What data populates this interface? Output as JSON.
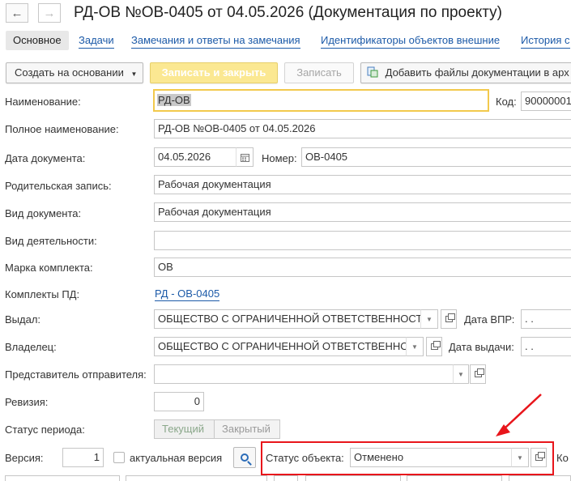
{
  "window": {
    "title": "РД-ОВ №ОВ-0405 от 04.05.2026 (Документация по проекту)"
  },
  "nav": {
    "back_glyph": "←",
    "forward_glyph": "→"
  },
  "tabs": [
    {
      "label": "Основное"
    },
    {
      "label": "Задачи"
    },
    {
      "label": "Замечания и ответы на замечания"
    },
    {
      "label": "Идентификаторы объектов внешние"
    },
    {
      "label": "История с"
    }
  ],
  "toolbar": {
    "create_based_label": "Создать на основании",
    "save_close_label": "Записать и закрыть",
    "save_label": "Записать",
    "add_files_label": "Добавить файлы документации в арх"
  },
  "form": {
    "name_label": "Наименование:",
    "name_value": "РД-ОВ",
    "code_label": "Код:",
    "code_value": "90000001",
    "full_name_label": "Полное наименование:",
    "full_name_value": "РД-ОВ №ОВ-0405 от 04.05.2026",
    "doc_date_label": "Дата документа:",
    "doc_date_value": "04.05.2026",
    "number_label": "Номер:",
    "number_value": "ОВ-0405",
    "parent_label": "Родительская запись:",
    "parent_value": "Рабочая документация",
    "doc_type_label": "Вид документа:",
    "doc_type_value": "Рабочая документация",
    "activity_label": "Вид деятельности:",
    "activity_value": "",
    "mark_label": "Марка комплекта:",
    "mark_value": "ОВ",
    "pd_sets_label": "Комплекты ПД:",
    "pd_sets_value": "РД - ОВ-0405",
    "issued_label": "Выдал:",
    "issued_value": "ОБЩЕСТВО С ОГРАНИЧЕННОЙ ОТВЕТСТВЕННОСТЬЮ",
    "vpr_date_label": "Дата ВПР:",
    "vpr_date_value": " .  .",
    "owner_label": "Владелец:",
    "owner_value": "ОБЩЕСТВО С ОГРАНИЧЕННОЙ ОТВЕТСТВЕННОСТЬЮ",
    "issue_date_label": "Дата выдачи:",
    "issue_date_value": " .  .",
    "sender_rep_label": "Представитель отправителя:",
    "sender_rep_value": "",
    "revision_label": "Ревизия:",
    "revision_value": "0",
    "period_status_label": "Статус периода:",
    "period_current": "Текущий",
    "period_closed": "Закрытый",
    "version_label": "Версия:",
    "version_value": "1",
    "actual_version_label": "актуальная версия",
    "object_status_label": "Статус объекта:",
    "object_status_value": "Отменено",
    "cut_label": "Ко"
  },
  "colors": {
    "accent_link": "#1c5aa8",
    "primary_button": "#fbe892",
    "focus_border": "#f2c94c",
    "annotation_red": "#e8151b"
  }
}
